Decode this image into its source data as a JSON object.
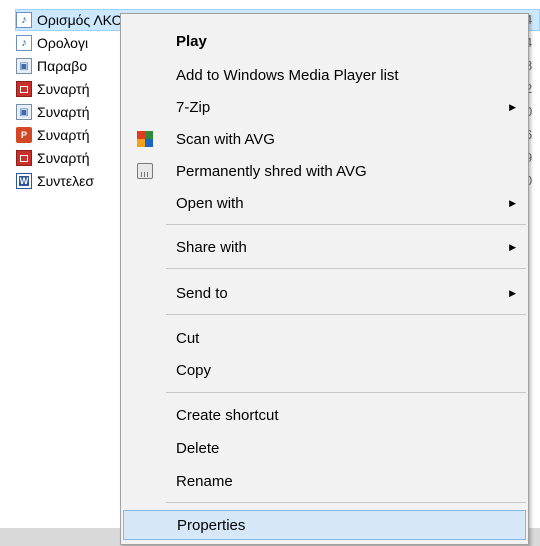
{
  "files": [
    {
      "name": "Ορισμός ΛΚΟ",
      "meta": "4",
      "icon": "audio-file-icon",
      "selected": true
    },
    {
      "name": "Ορολογι",
      "meta": "4",
      "icon": "audio-file-icon"
    },
    {
      "name": "Παραβο",
      "meta": "8",
      "icon": "image-file-icon"
    },
    {
      "name": "Συναρτή",
      "meta": "2",
      "icon": "presentation-file-icon"
    },
    {
      "name": "Συναρτή",
      "meta": "0",
      "icon": "image-file-icon"
    },
    {
      "name": "Συναρτή",
      "meta": "6",
      "icon": "powerpoint-file-icon"
    },
    {
      "name": "Συναρτή",
      "meta": "9",
      "icon": "presentation-file-icon"
    },
    {
      "name": "Συντελεσ",
      "meta": "0",
      "icon": "word-file-icon"
    }
  ],
  "menu": {
    "play": "Play",
    "add_to_wmp": "Add to Windows Media Player list",
    "seven_zip": "7-Zip",
    "scan_avg": "Scan with AVG",
    "shred_avg": "Permanently shred with AVG",
    "open_with": "Open with",
    "share_with": "Share with",
    "send_to": "Send to",
    "cut": "Cut",
    "copy": "Copy",
    "create_shortcut": "Create shortcut",
    "delete": "Delete",
    "rename": "Rename",
    "properties": "Properties",
    "submenu_arrow": "▶"
  },
  "colors": {
    "selection": "#cce8ff",
    "menu_background": "#f2f2f2",
    "highlight": "#d6e8f8"
  }
}
